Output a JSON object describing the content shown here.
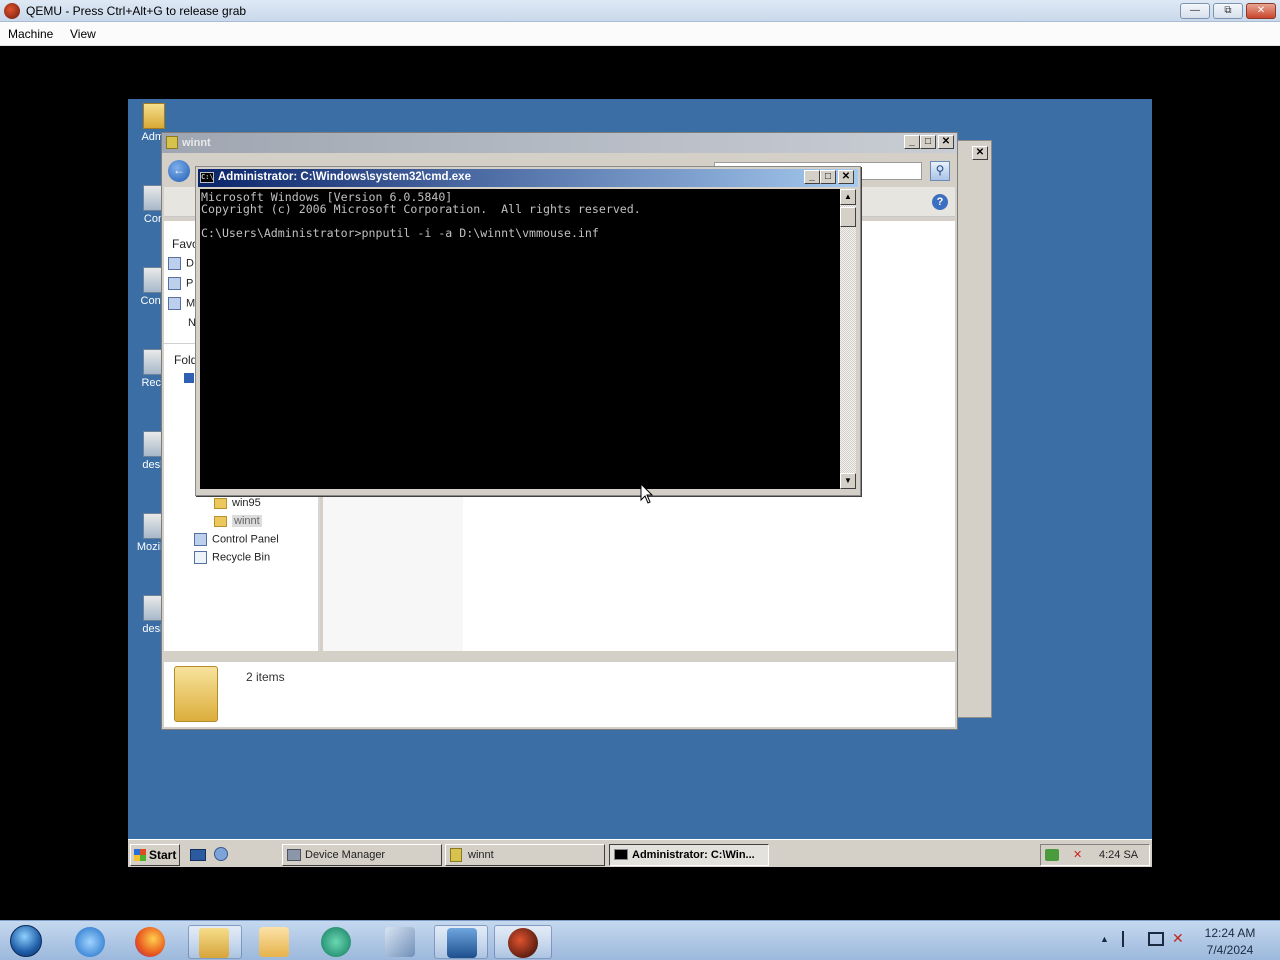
{
  "host": {
    "title": "QEMU - Press Ctrl+Alt+G to release grab",
    "menu": [
      "Machine",
      "View"
    ],
    "clock_time": "12:24 AM",
    "clock_date": "7/4/2024"
  },
  "guest": {
    "desktop_icons": [
      "Admi",
      "Con",
      "Contr",
      "Recy",
      "desk",
      "Mozilla",
      "desk"
    ],
    "explorer": {
      "title": "winnt",
      "favorites_label": "Favo",
      "folders_label": "Fold",
      "sidebar_letters": [
        "D",
        "P",
        "M",
        "N"
      ],
      "tree": [
        "win95",
        "winnt",
        "Control Panel",
        "Recycle Bin"
      ],
      "status": "2 items"
    },
    "cmd": {
      "title": "Administrator: C:\\Windows\\system32\\cmd.exe",
      "lines": [
        "Microsoft Windows [Version 6.0.5840]",
        "Copyright (c) 2006 Microsoft Corporation.  All rights reserved.",
        "",
        "C:\\Users\\Administrator>pnputil -i -a D:\\winnt\\vmmouse.inf"
      ]
    },
    "taskbar": {
      "start": "Start",
      "buttons": [
        "Device Manager",
        "winnt",
        "Administrator: C:\\Win..."
      ],
      "tray_time": "4:24 SA"
    }
  }
}
